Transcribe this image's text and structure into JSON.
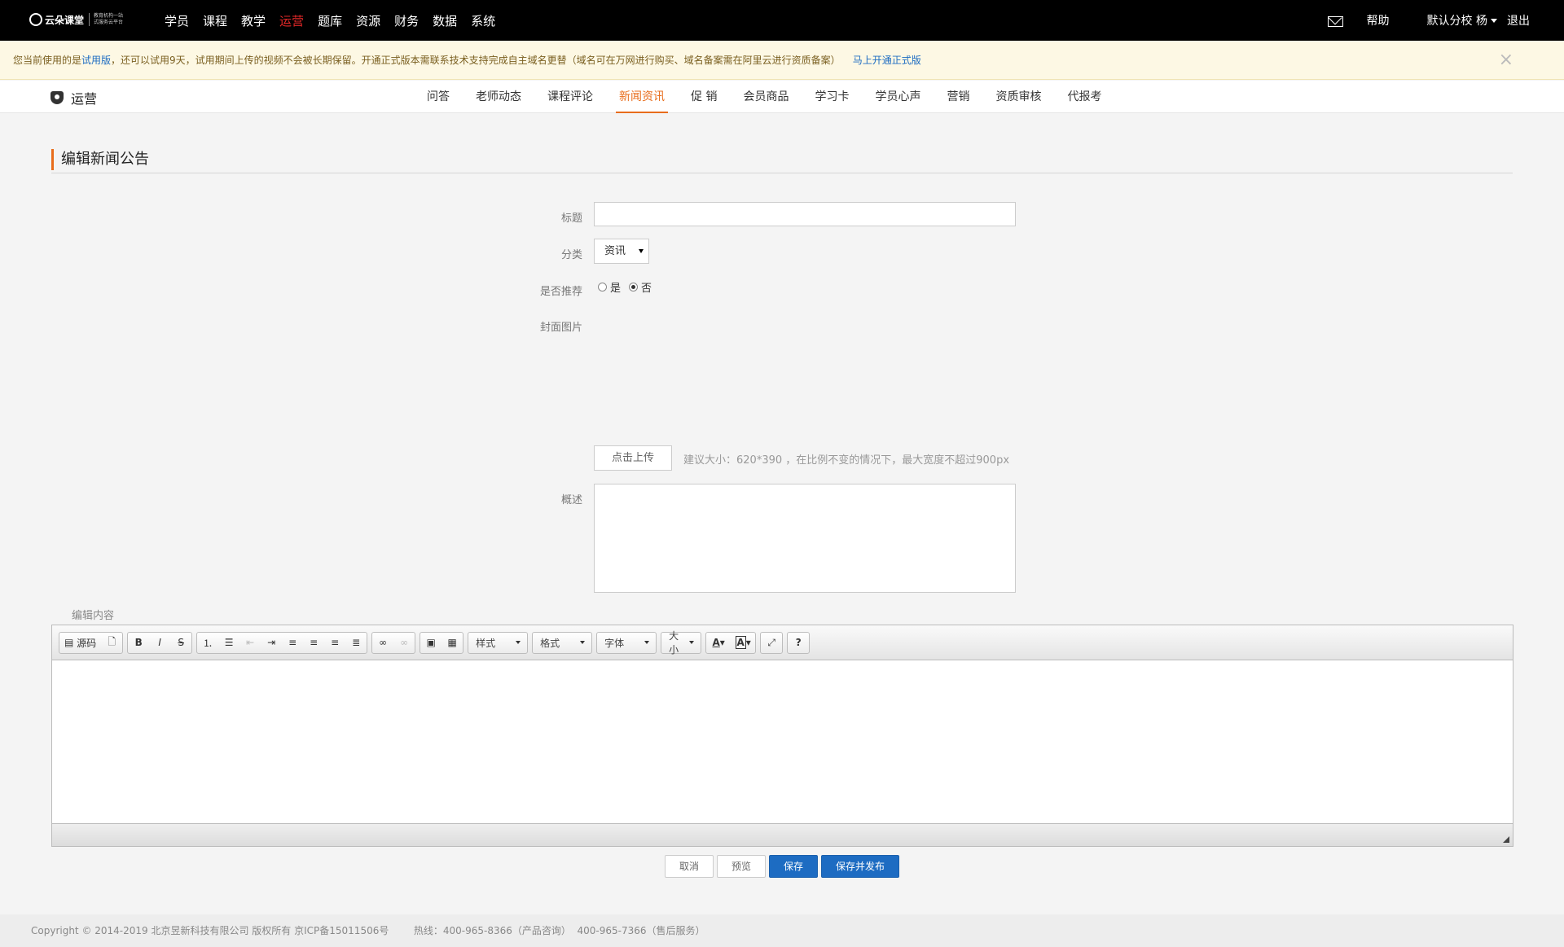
{
  "brand": {
    "name": "云朵课堂",
    "sub1": "教育机构一站",
    "sub2": "式服务云平台"
  },
  "topnav": [
    "学员",
    "课程",
    "教学",
    "运营",
    "题库",
    "资源",
    "财务",
    "数据",
    "系统"
  ],
  "topnav_active": "运营",
  "topright": {
    "help": "帮助",
    "school": "默认分校",
    "user": "杨",
    "logout": "退出"
  },
  "notice": {
    "prefix": "您当前使用的是",
    "trial": "试用版",
    "text": "，还可以试用9天，试用期间上传的视频不会被长期保留。开通正式版本需联系技术支持完成自主域名更替（域名可在万网进行购买、域名备案需在阿里云进行资质备案）",
    "link": "马上开通正式版",
    "close": "×"
  },
  "subnav": {
    "title": "运营",
    "tabs": [
      "问答",
      "老师动态",
      "课程评论",
      "新闻资讯",
      "促 销",
      "会员商品",
      "学习卡",
      "学员心声",
      "营销",
      "资质审核",
      "代报考"
    ],
    "active": "新闻资讯"
  },
  "form": {
    "page_title": "编辑新闻公告",
    "title_label": "标题",
    "title_value": "",
    "category_label": "分类",
    "category_value": "资讯",
    "recommend_label": "是否推荐",
    "yes": "是",
    "no": "否",
    "recommend_value": "否",
    "cover_label": "封面图片",
    "upload": "点击上传",
    "upload_hint": "建议大小：620*390 ，在比例不变的情况下，最大宽度不超过900px",
    "summary_label": "概述",
    "summary_value": "",
    "content_label": "编辑内容"
  },
  "editor": {
    "source": "源码",
    "style": "样式",
    "format": "格式",
    "font": "字体",
    "size": "大小"
  },
  "buttons": {
    "cancel": "取消",
    "preview": "预览",
    "save": "保存",
    "save_publish": "保存并发布"
  },
  "footer": "Copyright © 2014-2019 北京昱新科技有限公司 版权所有 京ICP备15011506号        热线：400-965-8366（产品咨询）  400-965-7366（售后服务）",
  "colors": {
    "accent": "#e86d1c",
    "primary": "#1d6cc2",
    "topnav_active": "#e32828"
  }
}
